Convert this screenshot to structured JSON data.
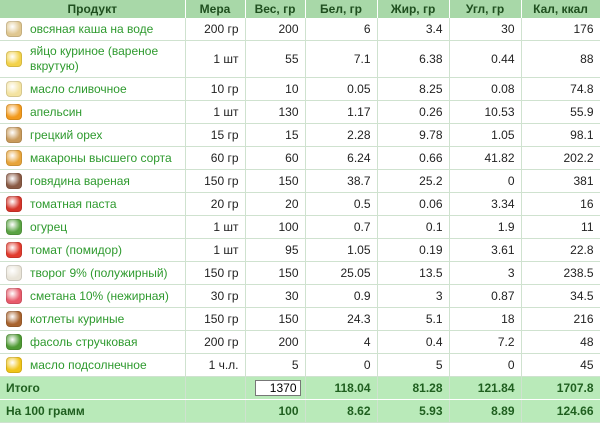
{
  "headers": {
    "product": "Продукт",
    "measure": "Мера",
    "weight": "Вес, гр",
    "protein": "Бел, гр",
    "fat": "Жир, гр",
    "carbs": "Угл, гр",
    "kcal": "Кал, ккал"
  },
  "rows": [
    {
      "name": "овсяная каша на воде",
      "measure": "200 гр",
      "weight": "200",
      "protein": "6",
      "fat": "3.4",
      "carbs": "30",
      "kcal": "176",
      "icon": "oatmeal-icon",
      "color": "#e0c790"
    },
    {
      "name": "яйцо куриное (вареное вкрутую)",
      "measure": "1 шт",
      "weight": "55",
      "protein": "7.1",
      "fat": "6.38",
      "carbs": "0.44",
      "kcal": "88",
      "icon": "boiled-egg-icon",
      "color": "#f3d24a"
    },
    {
      "name": "масло сливочное",
      "measure": "10 гр",
      "weight": "10",
      "protein": "0.05",
      "fat": "8.25",
      "carbs": "0.08",
      "kcal": "74.8",
      "icon": "butter-icon",
      "color": "#f4e3a1"
    },
    {
      "name": "апельсин",
      "measure": "1 шт",
      "weight": "130",
      "protein": "1.17",
      "fat": "0.26",
      "carbs": "10.53",
      "kcal": "55.9",
      "icon": "orange-icon",
      "color": "#f29a1d"
    },
    {
      "name": "грецкий орех",
      "measure": "15 гр",
      "weight": "15",
      "protein": "2.28",
      "fat": "9.78",
      "carbs": "1.05",
      "kcal": "98.1",
      "icon": "walnut-icon",
      "color": "#c99b5c"
    },
    {
      "name": "макароны высшего сорта",
      "measure": "60 гр",
      "weight": "60",
      "protein": "6.24",
      "fat": "0.66",
      "carbs": "41.82",
      "kcal": "202.2",
      "icon": "pasta-icon",
      "color": "#e7a43b"
    },
    {
      "name": "говядина вареная",
      "measure": "150 гр",
      "weight": "150",
      "protein": "38.7",
      "fat": "25.2",
      "carbs": "0",
      "kcal": "381",
      "icon": "beef-icon",
      "color": "#8a5a44"
    },
    {
      "name": "томатная паста",
      "measure": "20 гр",
      "weight": "20",
      "protein": "0.5",
      "fat": "0.06",
      "carbs": "3.34",
      "kcal": "16",
      "icon": "tomato-paste-icon",
      "color": "#d6352a"
    },
    {
      "name": "огурец",
      "measure": "1 шт",
      "weight": "100",
      "protein": "0.7",
      "fat": "0.1",
      "carbs": "1.9",
      "kcal": "11",
      "icon": "cucumber-icon",
      "color": "#5aa343"
    },
    {
      "name": "томат (помидор)",
      "measure": "1 шт",
      "weight": "95",
      "protein": "1.05",
      "fat": "0.19",
      "carbs": "3.61",
      "kcal": "22.8",
      "icon": "tomato-icon",
      "color": "#e23b2e"
    },
    {
      "name": "творог 9% (полужирный)",
      "measure": "150 гр",
      "weight": "150",
      "protein": "25.05",
      "fat": "13.5",
      "carbs": "3",
      "kcal": "238.5",
      "icon": "cottage-cheese-icon",
      "color": "#e9e4d8"
    },
    {
      "name": "сметана 10% (нежирная)",
      "measure": "30 гр",
      "weight": "30",
      "protein": "0.9",
      "fat": "3",
      "carbs": "0.87",
      "kcal": "34.5",
      "icon": "sour-cream-icon",
      "color": "#e85b6b"
    },
    {
      "name": "котлеты куриные",
      "measure": "150 гр",
      "weight": "150",
      "protein": "24.3",
      "fat": "5.1",
      "carbs": "18",
      "kcal": "216",
      "icon": "chicken-cutlet-icon",
      "color": "#a8632e"
    },
    {
      "name": "фасоль стручковая",
      "measure": "200 гр",
      "weight": "200",
      "protein": "4",
      "fat": "0.4",
      "carbs": "7.2",
      "kcal": "48",
      "icon": "green-beans-icon",
      "color": "#4f9a34"
    },
    {
      "name": "масло подсолнечное",
      "measure": "1 ч.л.",
      "weight": "5",
      "protein": "0",
      "fat": "5",
      "carbs": "0",
      "kcal": "45",
      "icon": "sunflower-oil-icon",
      "color": "#f0c419"
    }
  ],
  "total": {
    "label": "Итого",
    "weight": "1370",
    "protein": "118.04",
    "fat": "81.28",
    "carbs": "121.84",
    "kcal": "1707.8"
  },
  "per100": {
    "label": "На 100 грамм",
    "weight": "100",
    "protein": "8.62",
    "fat": "5.93",
    "carbs": "8.89",
    "kcal": "124.66"
  }
}
